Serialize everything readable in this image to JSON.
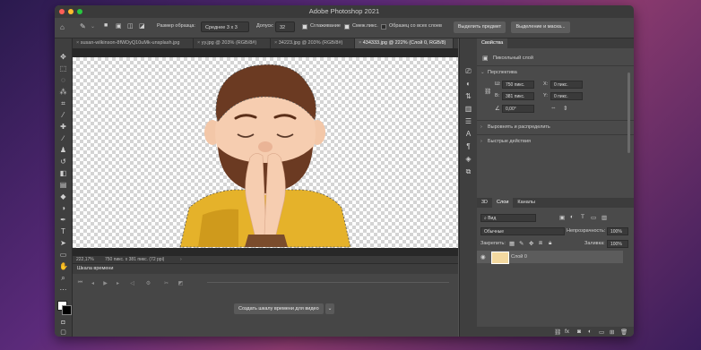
{
  "window": {
    "title": "Adobe Photoshop 2021"
  },
  "options_bar": {
    "sample_size_label": "Размер образца:",
    "sample_size_value": "Среднее 3 x 3",
    "tolerance_label": "Допуск:",
    "tolerance_value": "32",
    "anti_alias_label": "Сглаживание",
    "contiguous_label": "Смеж.пикс.",
    "sample_all_layers_label": "Образец со всех слоев",
    "select_subject_button": "Выделить предмет",
    "select_mask_button": "Выделение и маска..."
  },
  "doc_tabs": [
    {
      "label": "susan-wilkinson-8fWDyQ10uMk-unsplash.jpg",
      "active": false
    },
    {
      "label": "yy.jpg @ 203% (RGB/8#)",
      "active": false
    },
    {
      "label": "34223.jpg @ 203% (RGB/8#)",
      "active": false
    },
    {
      "label": "434333.jpg @ 222% (Слой 0, RGB/8)",
      "active": true
    }
  ],
  "status_bar": {
    "zoom": "222,17%",
    "size": "750 пикс. x 381 пикс. (72 ppi)"
  },
  "timeline": {
    "title": "Шкала времени",
    "create_button": "Создать шкалу времени для видео"
  },
  "properties": {
    "tab": "Свойства",
    "layer_type": "Пиксельный слой",
    "section_perspective": "Перспектива",
    "w_label": "Ш:",
    "w_value": "750 пикс.",
    "x_label": "X:",
    "x_value": "0 пикс.",
    "h_label": "В:",
    "h_value": "381 пикс.",
    "y_label": "Y:",
    "y_value": "0 пикс.",
    "angle_value": "0,00°",
    "section_align": "Выровнять и распределить",
    "section_quick": "Быстрые действия"
  },
  "layers_panel": {
    "tabs": [
      "3D",
      "Слои",
      "Каналы"
    ],
    "active_tab": "Слои",
    "filter_value": "Вид",
    "blend_mode": "Обычные",
    "opacity_label": "Непрозрачность:",
    "opacity_value": "100%",
    "lock_label": "Закрепить:",
    "fill_label": "Заливка:",
    "fill_value": "100%",
    "layer_name": "Слой 0"
  }
}
